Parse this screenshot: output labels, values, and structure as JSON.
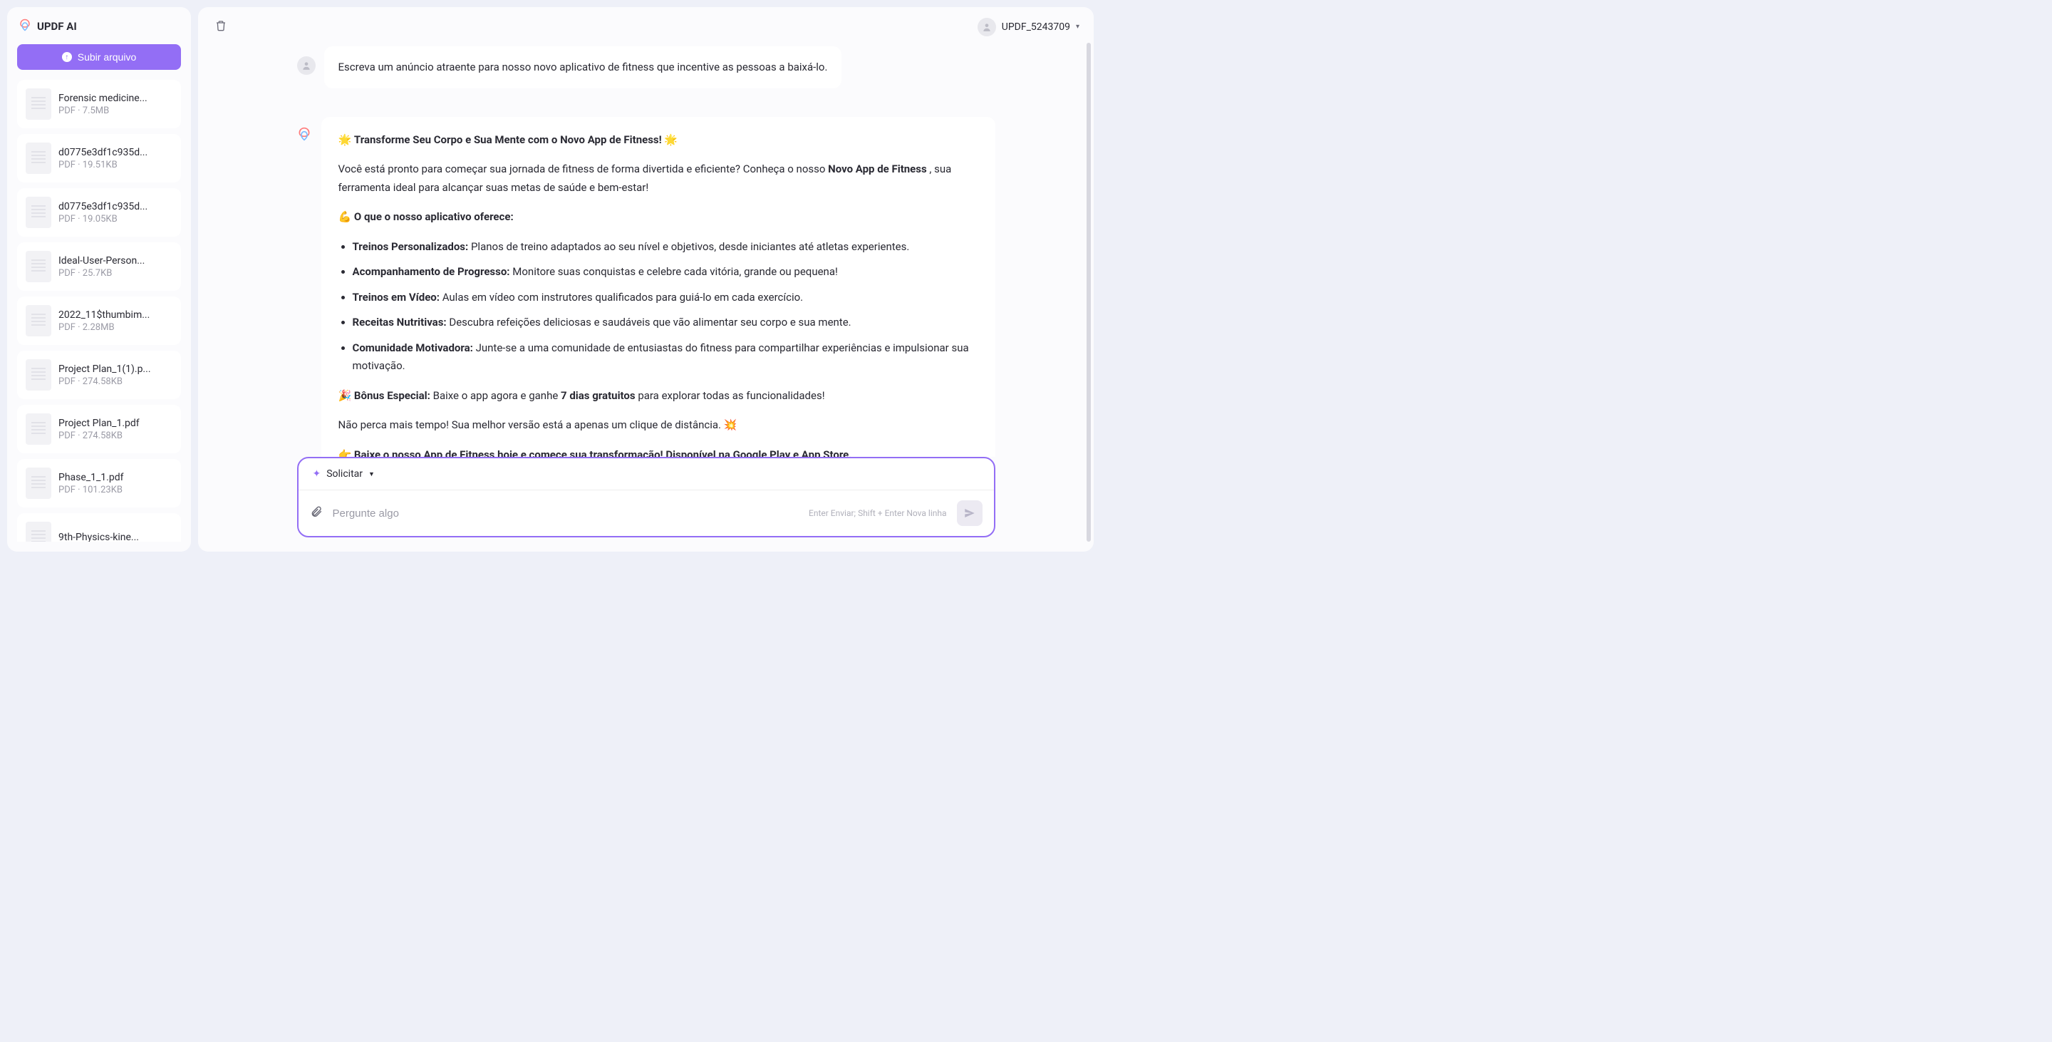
{
  "sidebar": {
    "title": "UPDF AI",
    "upload_label": "Subir arquivo",
    "files": [
      {
        "name": "Forensic medicine...",
        "meta": "PDF · 7.5MB"
      },
      {
        "name": "d0775e3df1c935d...",
        "meta": "PDF · 19.51KB"
      },
      {
        "name": "d0775e3df1c935d...",
        "meta": "PDF · 19.05KB"
      },
      {
        "name": "Ideal-User-Person...",
        "meta": "PDF · 25.7KB"
      },
      {
        "name": "2022_11$thumbim...",
        "meta": "PDF · 2.28MB"
      },
      {
        "name": "Project Plan_1(1).p...",
        "meta": "PDF · 274.58KB"
      },
      {
        "name": "Project Plan_1.pdf",
        "meta": "PDF · 274.58KB"
      },
      {
        "name": "Phase_1_1.pdf",
        "meta": "PDF · 101.23KB"
      },
      {
        "name": "9th-Physics-kine...",
        "meta": ""
      }
    ]
  },
  "header": {
    "username": "UPDF_5243709"
  },
  "chat": {
    "user_message": "Escreva um anúncio atraente para nosso novo aplicativo de fitness que incentive as pessoas a baixá-lo.",
    "ai": {
      "headline_prefix": "🌟 ",
      "headline_bold": "Transforme Seu Corpo e Sua Mente com o Novo App de Fitness!",
      "headline_suffix": " 🌟",
      "intro_1": "Você está pronto para começar sua jornada de fitness de forma divertida e eficiente? Conheça o nosso ",
      "intro_bold": "Novo App de Fitness",
      "intro_2": " , sua ferramenta ideal para alcançar suas metas de saúde e bem-estar!",
      "features_heading_prefix": "💪 ",
      "features_heading": "O que o nosso aplicativo oferece:",
      "features": [
        {
          "b": "Treinos Personalizados:",
          "t": " Planos de treino adaptados ao seu nível e objetivos, desde iniciantes até atletas experientes."
        },
        {
          "b": "Acompanhamento de Progresso:",
          "t": " Monitore suas conquistas e celebre cada vitória, grande ou pequena!"
        },
        {
          "b": "Treinos em Vídeo:",
          "t": " Aulas em vídeo com instrutores qualificados para guiá-lo em cada exercício."
        },
        {
          "b": "Receitas Nutritivas:",
          "t": " Descubra refeições deliciosas e saudáveis que vão alimentar seu corpo e sua mente."
        },
        {
          "b": "Comunidade Motivadora:",
          "t": " Junte-se a uma comunidade de entusiastas do fitness para compartilhar experiências e impulsionar sua motivação."
        }
      ],
      "bonus_prefix": "🎉 ",
      "bonus_b1": "Bônus Especial:",
      "bonus_mid": " Baixe o app agora e ganhe ",
      "bonus_b2": "7 dias gratuitos",
      "bonus_end": " para explorar todas as funcionalidades!",
      "closing_1": "Não perca mais tempo! Sua melhor versão está a apenas um clique de distância. 💥",
      "cta_prefix": "👉 ",
      "cta_bold": "Baixe o nosso App de Fitness hoje e comece sua transformação! Disponível na Google Play e App Store."
    }
  },
  "input": {
    "request_label": "Solicitar",
    "placeholder": "Pergunte algo",
    "hint": "Enter Enviar; Shift + Enter Nova linha"
  }
}
